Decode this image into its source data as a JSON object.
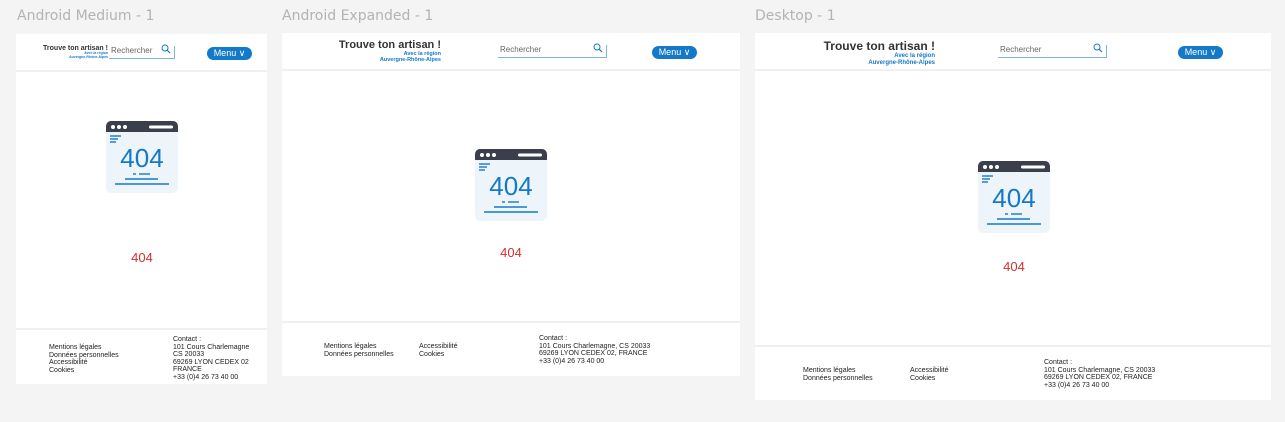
{
  "logo": {
    "title": "Trouve ton artisan !",
    "sub1": "Avec la région",
    "sub2": "Auvergne-Rhône-Alpes"
  },
  "search_placeholder": "Rechercher",
  "menu_label": "Menu ∨",
  "icon_text": "404",
  "error_text": "404",
  "colors": {
    "accent": "#1479c9",
    "error": "#d32f2f",
    "canvas": "#f4f4f4"
  },
  "frames": [
    {
      "title": "Android Medium - 1",
      "links": [
        [
          "Mentions légales",
          "Données personnelles",
          "Accessibilité",
          "Cookies"
        ]
      ],
      "contact": [
        "Contact :",
        "101 Cours Charlemagne",
        "CS 20033",
        "69269 LYON CEDEX 02",
        "FRANCE",
        "+33 (0)4 26 73 40 00"
      ]
    },
    {
      "title": "Android Expanded - 1",
      "links": [
        [
          "Mentions légales",
          "Données personnelles"
        ],
        [
          "Accessibilité",
          "Cookies"
        ]
      ],
      "contact": [
        "Contact :",
        "101 Cours Charlemagne, CS 20033",
        "69269 LYON CEDEX 02, FRANCE",
        "+33 (0)4 26 73 40 00"
      ]
    },
    {
      "title": "Desktop - 1",
      "links": [
        [
          "Mentions légales",
          "Données personnelles"
        ],
        [
          "Accessibilité",
          "Cookies"
        ]
      ],
      "contact": [
        "Contact :",
        "101 Cours Charlemagne, CS 20033",
        "69269 LYON CEDEX 02, FRANCE",
        "+33 (0)4 26 73 40 00"
      ]
    }
  ]
}
